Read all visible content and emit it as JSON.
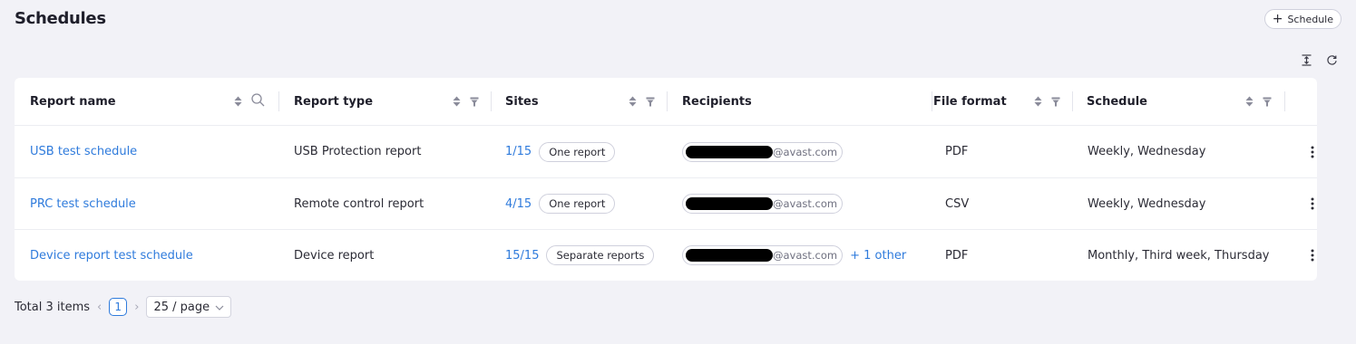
{
  "header": {
    "title": "Schedules",
    "add_button": "Schedule"
  },
  "toolbar": {
    "icons": [
      "row-height-icon",
      "refresh-icon"
    ]
  },
  "table": {
    "columns": [
      "Report name",
      "Report type",
      "Sites",
      "Recipients",
      "File format",
      "Schedule"
    ],
    "rows": [
      {
        "name": "USB test schedule",
        "type": "USB Protection report",
        "sites": "1/15",
        "sites_badge": "One report",
        "recipient": "@avast.com",
        "extra": "",
        "format": "PDF",
        "schedule": "Weekly, Wednesday"
      },
      {
        "name": "PRC test schedule",
        "type": "Remote control report",
        "sites": "4/15",
        "sites_badge": "One report",
        "recipient": "@avast.com",
        "extra": "",
        "format": "CSV",
        "schedule": "Weekly, Wednesday"
      },
      {
        "name": "Device report test schedule",
        "type": "Device report",
        "sites": "15/15",
        "sites_badge": "Separate reports",
        "recipient": "@avast.com",
        "extra": "+ 1 other",
        "format": "PDF",
        "schedule": "Monthly, Third week, Thursday"
      }
    ]
  },
  "footer": {
    "total": "Total 3 items",
    "current_page": "1",
    "page_size": "25 / page"
  },
  "colors": {
    "accent": "#2f7bdc",
    "background": "#f2f2f7",
    "card": "#ffffff"
  }
}
